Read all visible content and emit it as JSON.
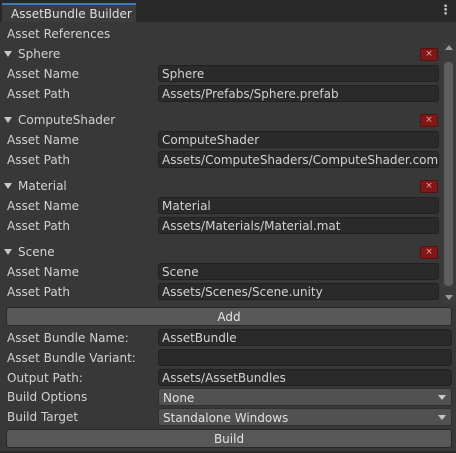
{
  "window": {
    "tab_title": "AssetBundle Builder",
    "menu_icon": "kebab-menu-icon"
  },
  "asset_references": {
    "heading": "Asset References",
    "items": [
      {
        "name": "Sphere",
        "name_label": "Asset Name",
        "path_label": "Asset Path",
        "asset_name": "Sphere",
        "asset_path": "Assets/Prefabs/Sphere.prefab",
        "remove": "×"
      },
      {
        "name": "ComputeShader",
        "name_label": "Asset Name",
        "path_label": "Asset Path",
        "asset_name": "ComputeShader",
        "asset_path": "Assets/ComputeShaders/ComputeShader.comput",
        "remove": "×"
      },
      {
        "name": "Material",
        "name_label": "Asset Name",
        "path_label": "Asset Path",
        "asset_name": "Material",
        "asset_path": "Assets/Materials/Material.mat",
        "remove": "×"
      },
      {
        "name": "Scene",
        "name_label": "Asset Name",
        "path_label": "Asset Path",
        "asset_name": "Scene",
        "asset_path": "Assets/Scenes/Scene.unity",
        "remove": "×"
      }
    ],
    "add_label": "Add"
  },
  "settings": {
    "bundle_name_label": "Asset Bundle Name:",
    "bundle_name": "AssetBundle",
    "bundle_variant_label": "Asset Bundle Variant:",
    "bundle_variant": "",
    "output_path_label": "Output Path:",
    "output_path": "Assets/AssetBundles",
    "build_options_label": "Build Options",
    "build_options": "None",
    "build_target_label": "Build Target",
    "build_target": "Standalone Windows"
  },
  "build_label": "Build",
  "colors": {
    "background": "#383838",
    "titlebar": "#282828",
    "tab_accent": "#3a79bb",
    "remove_button": "#7d1919",
    "field": "#2a2a2a",
    "button": "#585858"
  }
}
